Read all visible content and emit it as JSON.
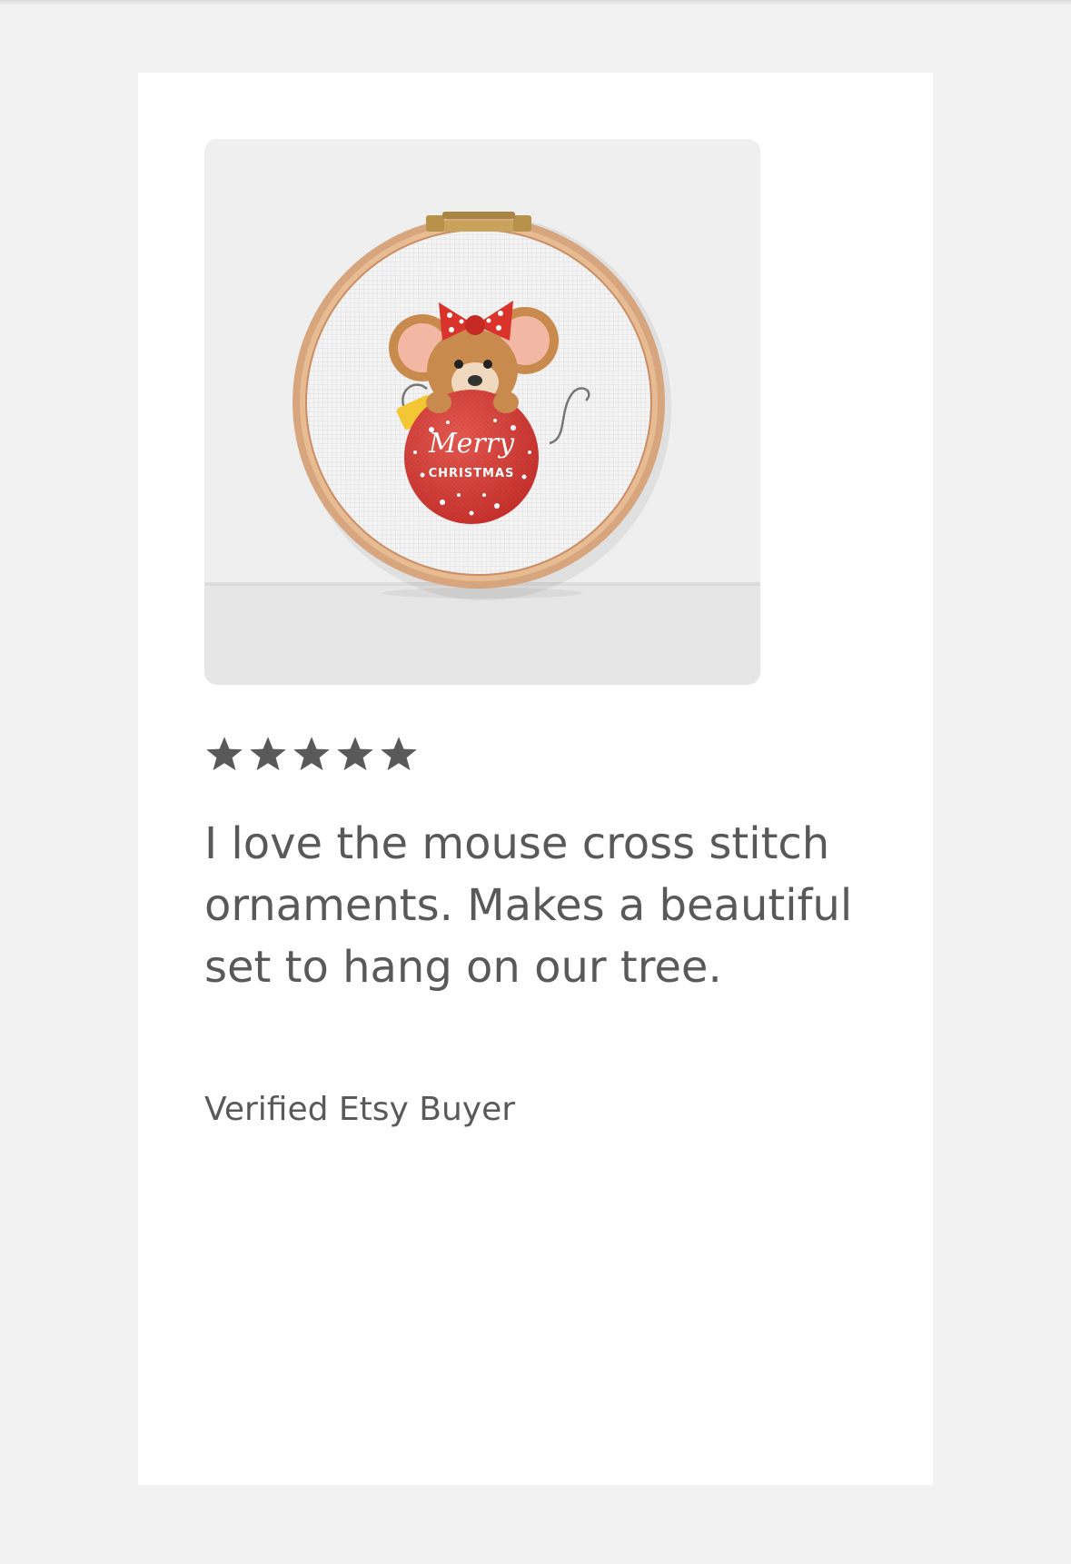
{
  "review": {
    "rating": 5,
    "rating_max": 5,
    "text": "I love the mouse cross stitch ornaments. Makes a beautiful set to hang on our tree.",
    "reviewer": "Verified Etsy Buyer",
    "star_color": "#595959"
  },
  "photo": {
    "ornament_script": "Merry",
    "ornament_caption": "CHRISTMAS"
  },
  "colors": {
    "page_background": "#f2f2f2",
    "card_background": "#ffffff",
    "text": "#595959"
  }
}
